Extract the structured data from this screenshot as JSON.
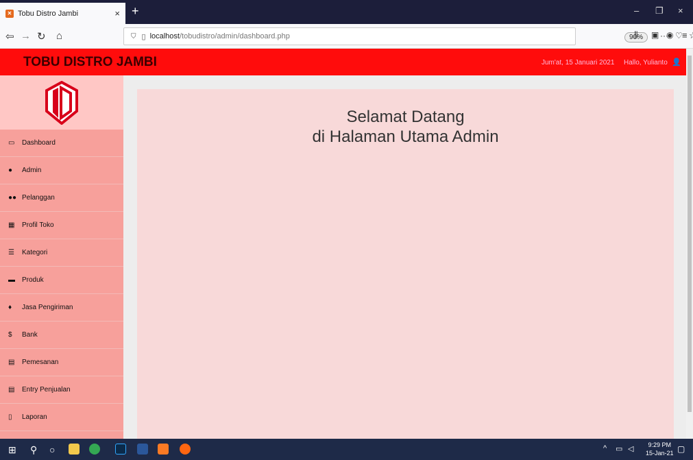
{
  "browser": {
    "tab_title": "Tobu Distro Jambi",
    "tab_close": "×",
    "new_tab": "+",
    "url_host": "localhost",
    "url_path": "/tobudistro/admin/dashboard.php",
    "zoom": "90%",
    "more": "···",
    "minimize": "–",
    "restore": "❐",
    "close": "×"
  },
  "header": {
    "brand": "TOBU DISTRO JAMBI",
    "date": "Jum'at, 15 Januari 2021",
    "greeting": "Hallo, Yulianto"
  },
  "sidebar": {
    "items": [
      {
        "label": "Dashboard",
        "icon": "monitor-icon"
      },
      {
        "label": "Admin",
        "icon": "user-icon"
      },
      {
        "label": "Pelanggan",
        "icon": "users-icon"
      },
      {
        "label": "Profil Toko",
        "icon": "table-icon"
      },
      {
        "label": "Kategori",
        "icon": "list-icon"
      },
      {
        "label": "Produk",
        "icon": "briefcase-icon"
      },
      {
        "label": "Jasa Pengiriman",
        "icon": "map-marker-icon"
      },
      {
        "label": "Bank",
        "icon": "dollar-icon"
      },
      {
        "label": "Pemesanan",
        "icon": "credit-card-icon"
      },
      {
        "label": "Entry Penjualan",
        "icon": "credit-card-icon"
      },
      {
        "label": "Laporan",
        "icon": "file-icon"
      }
    ]
  },
  "main": {
    "welcome_line1": "Selamat Datang",
    "welcome_line2": "di Halaman Utama Admin"
  },
  "taskbar": {
    "time": "9:29 PM",
    "date": "15-Jan-21"
  },
  "colors": {
    "header_red": "#ff0c0c",
    "sidebar_pink": "#f7a09b",
    "card_pink": "#f8d9d9"
  }
}
